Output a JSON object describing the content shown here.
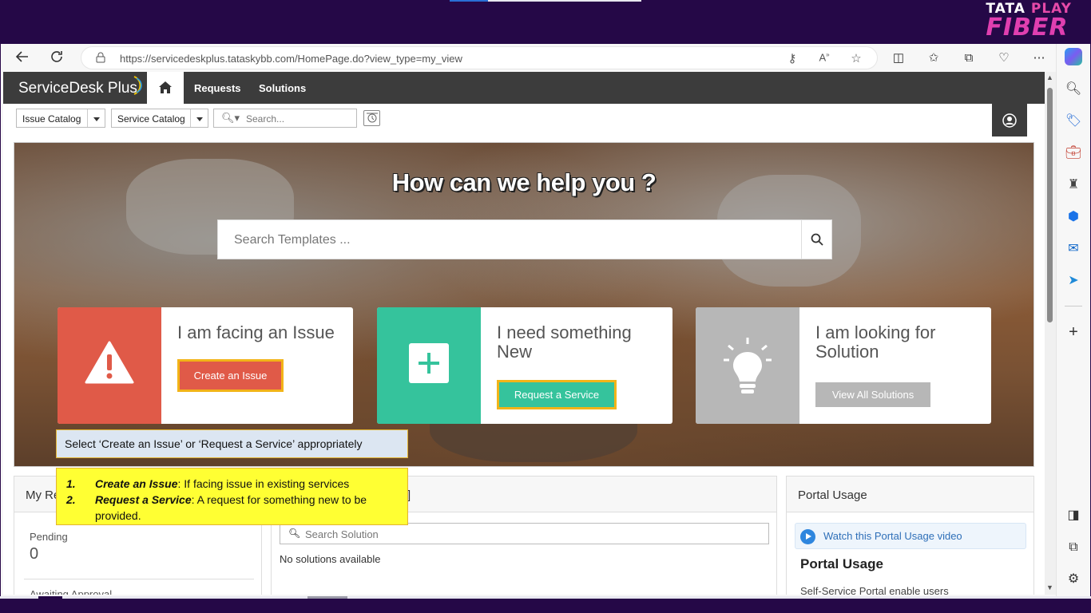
{
  "brand": {
    "line1_a": "TATA",
    "line1_b": " PLAY",
    "line2": "FIBER"
  },
  "browser": {
    "url_host": "https://servicedeskplus.tataskybb.com",
    "url_path": "/HomePage.do?view_type=my_view"
  },
  "app": {
    "logo": "ServiceDesk Plus",
    "nav": {
      "requests": "Requests",
      "solutions": "Solutions"
    },
    "toolbar": {
      "issue_catalog": "Issue Catalog",
      "service_catalog": "Service Catalog",
      "search_placeholder": "Search..."
    }
  },
  "hero": {
    "title": "How can we help you ?",
    "search_placeholder": "Search Templates ...",
    "cards": [
      {
        "title": "I am facing an Issue",
        "button": "Create an Issue",
        "color": "#e05a48"
      },
      {
        "title": "I need something New",
        "button": "Request a Service",
        "color": "#35c39c"
      },
      {
        "title": "I am looking for Solution",
        "button": "View All Solutions",
        "color": "#b7b7b7"
      }
    ]
  },
  "annotations": {
    "note1": "Select ‘Create an Issue’ or ‘Request a Service’ appropriately",
    "note2": [
      {
        "num": "1.",
        "term": "Create an Issue",
        "text": ": If facing issue in existing services"
      },
      {
        "num": "2.",
        "term": " Request a Service",
        "text": ": A request for something new to be provided."
      }
    ]
  },
  "panels": {
    "my_requests": {
      "title_partial": "My Re",
      "pending_label": "Pending",
      "pending_count": "0",
      "awaiting_label": "Awaiting Approval"
    },
    "solutions": {
      "title_partial": "]",
      "search_placeholder": "Search Solution",
      "empty": "No solutions available"
    },
    "portal": {
      "title": "Portal Usage",
      "video_link": "Watch this Portal Usage video",
      "heading": "Portal Usage",
      "desc": "Self-Service Portal enable users"
    }
  }
}
